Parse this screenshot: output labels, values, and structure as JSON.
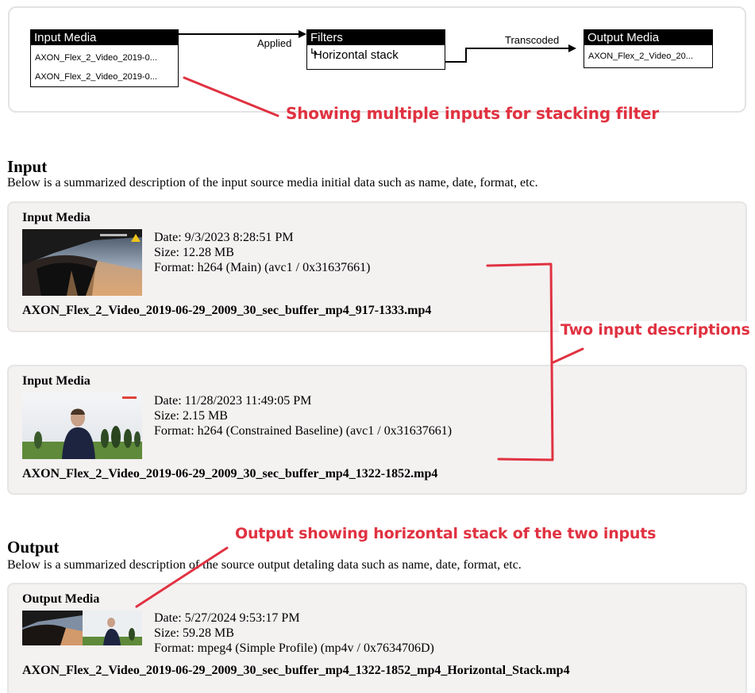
{
  "flow": {
    "input_node": {
      "title": "Input Media",
      "items": [
        "AXON_Flex_2_Video_2019-0...",
        "AXON_Flex_2_Video_2019-0..."
      ]
    },
    "filters_node": {
      "title": "Filters",
      "items": [
        "Horizontal stack"
      ]
    },
    "output_node": {
      "title": "Output Media",
      "items": [
        "AXON_Flex_2_Video_20..."
      ]
    },
    "edge_applied": "Applied",
    "edge_transcoded": "Transcoded"
  },
  "annotations": {
    "multi_inputs": "Showing multiple inputs for stacking filter",
    "two_inputs": "Two input descriptions",
    "output_stack": "Output showing horizontal stack of the two inputs",
    "color": "#e03241"
  },
  "input_section": {
    "title": "Input",
    "description": "Below is a summarized description of the input source media initial data such as name, date, format, etc.",
    "cards": [
      {
        "label": "Input Media",
        "date": "Date: 9/3/2023 8:28:51 PM",
        "size": "Size: 12.28 MB",
        "format": "Format: h264 (Main) (avc1 / 0x31637661)",
        "file_name": "AXON_Flex_2_Video_2019-06-29_2009_30_sec_buffer_mp4_917-1333.mp4",
        "thumbnail": "vehicle-dashcam-thumbnail"
      },
      {
        "label": "Input Media",
        "date": "Date: 11/28/2023 11:49:05 PM",
        "size": "Size: 2.15 MB",
        "format": "Format: h264 (Constrained Baseline) (avc1 / 0x31637661)",
        "file_name": "AXON_Flex_2_Video_2019-06-29_2009_30_sec_buffer_mp4_1322-1852.mp4",
        "thumbnail": "person-outdoor-thumbnail"
      }
    ]
  },
  "output_section": {
    "title": "Output",
    "description": "Below is a summarized description of the source output detaling data such as name, date, format, etc.",
    "card": {
      "label": "Output Media",
      "date": "Date: 5/27/2024 9:53:17 PM",
      "size": "Size: 59.28 MB",
      "format": "Format: mpeg4 (Simple Profile) (mp4v / 0x7634706D)",
      "file_name": "AXON_Flex_2_Video_2019-06-29_2009_30_sec_buffer_mp4_1322-1852_mp4_Horizontal_Stack.mp4",
      "thumbnail": "horizontal-stack-thumbnail"
    }
  }
}
